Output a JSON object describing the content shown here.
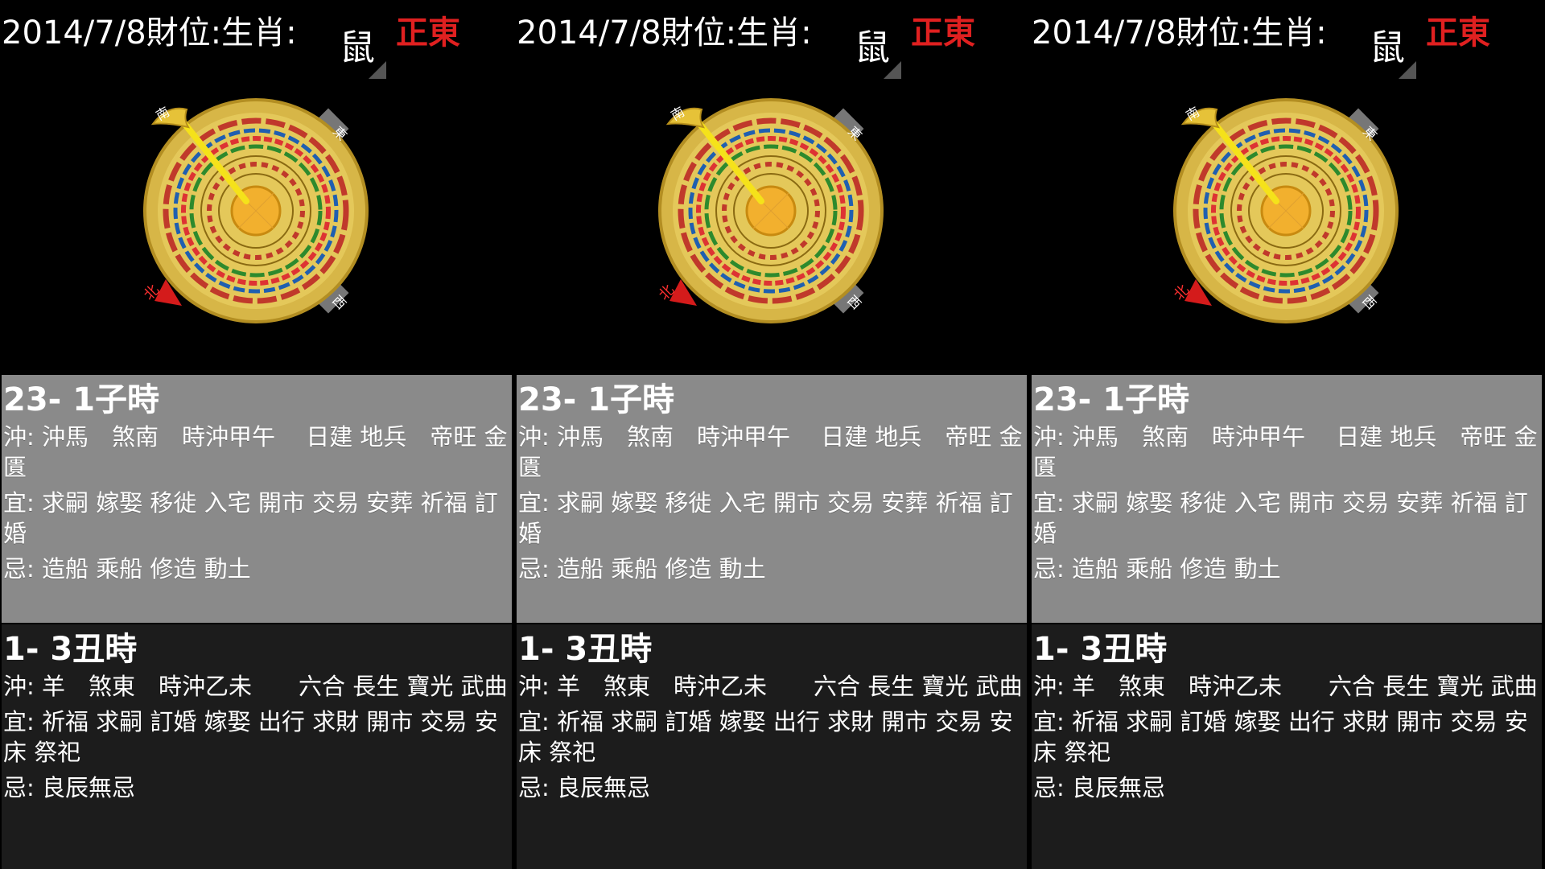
{
  "panels": [
    {
      "header": {
        "date_label": "2014/7/8財位:生肖:",
        "zodiac": "鼠",
        "direction": "正東"
      },
      "compass": {
        "marks": [
          "南",
          "東",
          "北",
          "西"
        ]
      },
      "slot1": {
        "title": "23- 1子時",
        "chong": "沖: 沖馬　煞南　時沖甲午　 日建 地兵　帝旺 金匱",
        "yi": "宜: 求嗣 嫁娶 移徙 入宅 開市 交易 安葬 祈福 訂婚",
        "ji": "忌: 造船 乘船 修造 動土"
      },
      "slot2": {
        "title": "1- 3丑時",
        "chong": "沖: 羊　煞東　時沖乙未　　六合 長生 寶光 武曲",
        "yi": "宜: 祈福 求嗣 訂婚 嫁娶 出行 求財 開市 交易 安床 祭祀",
        "ji": "忌: 良辰無忌"
      }
    },
    {
      "header": {
        "date_label": "2014/7/8財位:生肖:",
        "zodiac": "鼠",
        "direction": "正東"
      },
      "compass": {
        "marks": [
          "南",
          "東",
          "北",
          "西"
        ]
      },
      "slot1": {
        "title": "23- 1子時",
        "chong": "沖: 沖馬　煞南　時沖甲午　 日建 地兵　帝旺 金匱",
        "yi": "宜: 求嗣 嫁娶 移徙 入宅 開市 交易 安葬 祈福 訂婚",
        "ji": "忌: 造船 乘船 修造 動土"
      },
      "slot2": {
        "title": "1- 3丑時",
        "chong": "沖: 羊　煞東　時沖乙未　　六合 長生 寶光 武曲",
        "yi": "宜: 祈福 求嗣 訂婚 嫁娶 出行 求財 開市 交易 安床 祭祀",
        "ji": "忌: 良辰無忌"
      }
    },
    {
      "header": {
        "date_label": "2014/7/8財位:生肖:",
        "zodiac": "鼠",
        "direction": "正東"
      },
      "compass": {
        "marks": [
          "南",
          "東",
          "北",
          "西"
        ]
      },
      "slot1": {
        "title": "23- 1子時",
        "chong": "沖: 沖馬　煞南　時沖甲午　 日建 地兵　帝旺 金匱",
        "yi": "宜: 求嗣 嫁娶 移徙 入宅 開市 交易 安葬 祈福 訂婚",
        "ji": "忌: 造船 乘船 修造 動土"
      },
      "slot2": {
        "title": "1- 3丑時",
        "chong": "沖: 羊　煞東　時沖乙未　　六合 長生 寶光 武曲",
        "yi": "宜: 祈福 求嗣 訂婚 嫁娶 出行 求財 開市 交易 安床 祭祀",
        "ji": "忌: 良辰無忌"
      }
    }
  ],
  "colors": {
    "direction": "#e02020",
    "slot1_bg": "#8a8a8a",
    "slot2_bg": "#1c1c1c",
    "compass_gold": "#d8b43a"
  }
}
